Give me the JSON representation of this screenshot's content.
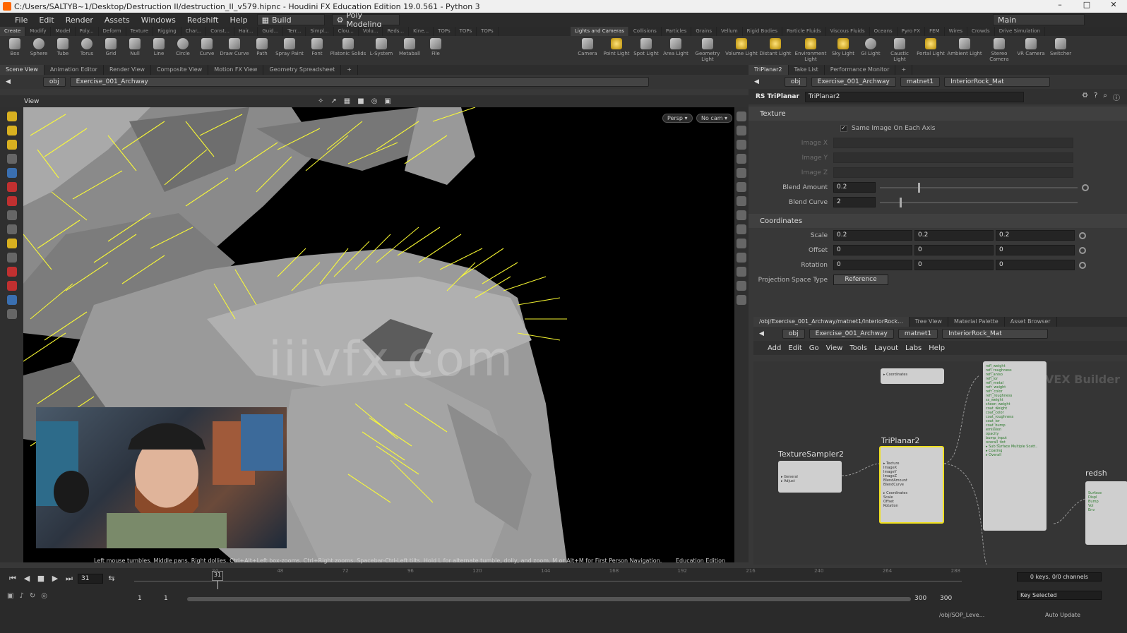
{
  "titlebar": {
    "title": "C:/Users/SALTYB~1/Desktop/Destruction II/destruction_II_v579.hipnc - Houdini FX Education Edition 19.0.561 - Python 3",
    "minimize": "–",
    "maximize": "□",
    "close": "✕"
  },
  "menu": {
    "items": [
      "File",
      "Edit",
      "Render",
      "Assets",
      "Windows",
      "Redshift",
      "Help"
    ],
    "desktop": "Build",
    "workspace": "Poly Modeling",
    "main": "Main"
  },
  "shelf_left": {
    "tabs": [
      "Create",
      "Modify",
      "Model",
      "Poly...",
      "Deform",
      "Texture",
      "Rigging",
      "Char...",
      "Const...",
      "Hair...",
      "Guid...",
      "Terr...",
      "Simpl...",
      "Clou...",
      "Volu...",
      "Reds...",
      "Kine...",
      "TOPs",
      "TOPs",
      "TOPs"
    ],
    "tools": [
      "Box",
      "Sphere",
      "Tube",
      "Torus",
      "Grid",
      "Null",
      "Line",
      "Circle",
      "Curve",
      "Draw Curve",
      "Path",
      "Spray Paint",
      "Font",
      "Platonic Solids",
      "L-System",
      "Metaball",
      "File"
    ]
  },
  "shelf_right": {
    "tabs": [
      "Lights and Cameras",
      "Collisions",
      "Particles",
      "Grains",
      "Vellum",
      "Rigid Bodies",
      "Particle Fluids",
      "Viscous Fluids",
      "Oceans",
      "Pyro FX",
      "FEM",
      "Wires",
      "Crowds",
      "Drive Simulation"
    ],
    "tools": [
      "Camera",
      "Point Light",
      "Spot Light",
      "Area Light",
      "Geometry Light",
      "Volume Light",
      "Distant Light",
      "Environment Light",
      "Sky Light",
      "GI Light",
      "Caustic Light",
      "Portal Light",
      "Ambient Light",
      "Stereo Camera",
      "VR Camera",
      "Switcher"
    ]
  },
  "viewer": {
    "tabs": [
      "Scene View",
      "Animation Editor",
      "Render View",
      "Composite View",
      "Motion FX View",
      "Geometry Spreadsheet"
    ],
    "path_root": "obj",
    "path_node": "Exercise_001_Archway",
    "label": "View",
    "persp": "Persp ▾",
    "cam": "No cam ▾",
    "help": "Left mouse tumbles. Middle pans. Right dollies. Ctrl+Alt+Left box-zooms. Ctrl+Right zooms. Spacebar-Ctrl-Left tilts. Hold L for alternate tumble, dolly, and zoom.    M or Alt+M for First Person Navigation.",
    "edition": "Education Edition",
    "watermark": "iiivfx.com"
  },
  "params": {
    "tabs": [
      "TriPlanar2",
      "Take List",
      "Performance Monitor"
    ],
    "path": [
      "obj",
      "Exercise_001_Archway",
      "matnet1",
      "InteriorRock_Mat"
    ],
    "node_type": "RS TriPlanar",
    "node_name": "TriPlanar2",
    "section_texture": "Texture",
    "same_image": "Same Image On Each Axis",
    "image_x": "Image X",
    "image_y": "Image Y",
    "image_z": "Image Z",
    "blend_amount_label": "Blend Amount",
    "blend_amount": "0.2",
    "blend_curve_label": "Blend Curve",
    "blend_curve": "2",
    "section_coords": "Coordinates",
    "scale_label": "Scale",
    "scale": [
      "0.2",
      "0.2",
      "0.2"
    ],
    "offset_label": "Offset",
    "offset": [
      "0",
      "0",
      "0"
    ],
    "rotation_label": "Rotation",
    "rotation": [
      "0",
      "0",
      "0"
    ],
    "proj_label": "Projection Space Type",
    "proj_value": "Reference"
  },
  "network": {
    "tabs": [
      "/obj/Exercise_001_Archway/matnet1/InteriorRock...",
      "Tree View",
      "Material Palette",
      "Asset Browser"
    ],
    "path": [
      "obj",
      "Exercise_001_Archway",
      "matnet1",
      "InteriorRock_Mat"
    ],
    "menu": [
      "Add",
      "Edit",
      "Go",
      "View",
      "Tools",
      "Layout",
      "Labs",
      "Help"
    ],
    "context": "VEX Builder",
    "node1": "TextureSampler2",
    "node2": "TriPlanar2",
    "node3": "redsh"
  },
  "timeline": {
    "frame": "31",
    "current_marker": "31",
    "start": "1",
    "start2": "1",
    "end": "300",
    "end2": "300",
    "ticks": [
      "24",
      "48",
      "72",
      "96",
      "120",
      "144",
      "168",
      "192",
      "216",
      "240",
      "264",
      "288"
    ],
    "keys": "0 keys, 0/0 channels",
    "key_selected": "Key Selected",
    "obj_path": "/obj/SOP_Leve...",
    "auto_update": "Auto Update"
  }
}
